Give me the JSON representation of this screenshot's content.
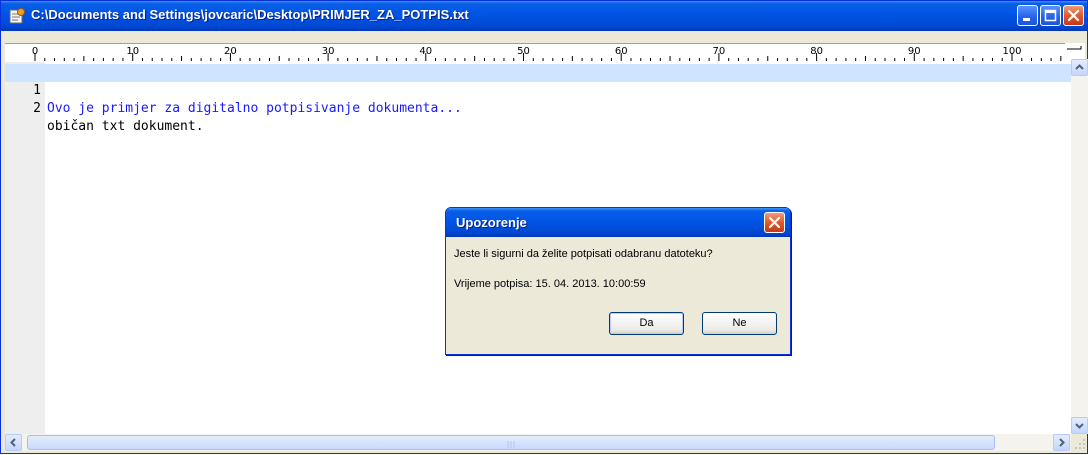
{
  "window": {
    "title": "C:\\Documents and Settings\\jovcaric\\Desktop\\PRIMJER_ZA_POTPIS.txt",
    "icon": "notepad-app-icon"
  },
  "ruler": {
    "labels": [
      "0",
      "10",
      "20",
      "30",
      "40",
      "50",
      "60",
      "70",
      "80",
      "90",
      "100"
    ]
  },
  "editor": {
    "lines": [
      {
        "number": "1",
        "text": "Ovo je primjer za digitalno potpisivanje dokumenta...",
        "active": true
      },
      {
        "number": "2",
        "text": "običan txt dokument.",
        "active": false
      }
    ]
  },
  "dialog": {
    "title": "Upozorenje",
    "message": "Jeste li sigurni da želite potpisati odabranu datoteku?",
    "timestamp": "Vrijeme potpisa: 15. 04. 2013. 10:00:59",
    "yes_label": "Da",
    "no_label": "Ne"
  },
  "colors": {
    "titlebar": "#0055e5",
    "active_line": "#cfe5ff",
    "active_text": "#1a1aff"
  }
}
